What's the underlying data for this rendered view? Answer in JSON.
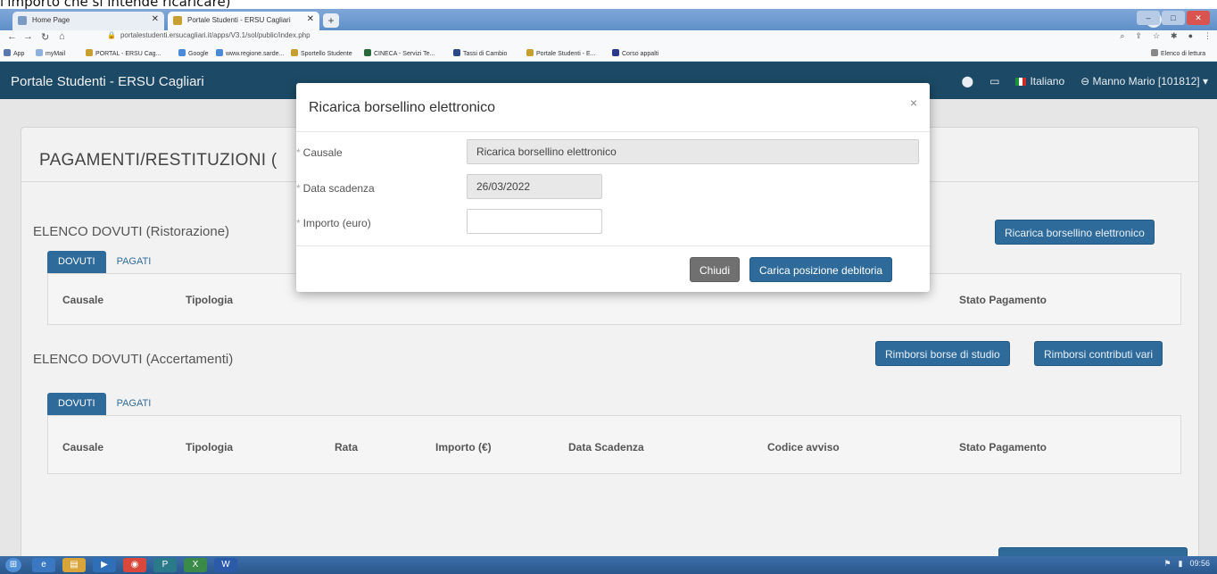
{
  "doc_fragment": "l'importo che si intende ricaricare)",
  "browser": {
    "tabs": [
      {
        "label": "Home Page"
      },
      {
        "label": "Portale Studenti - ERSU Cagliari"
      }
    ],
    "new_tab": "+",
    "url": "portalestudenti.ersucagliari.it/apps/V3.1/sol/public/index.php",
    "bookmarks": [
      "App",
      "myMail",
      "PORTAL - ERSU Cag...",
      "Google",
      "www.regione.sarde...",
      "Sportello Studente",
      "CINECA - Servizi Te...",
      "Tassi di Cambio",
      "Portale Studenti - E...",
      "Corso appalti"
    ],
    "reading_list": "Elenco di lettura"
  },
  "navbar": {
    "brand": "Portale Studenti - ERSU Cagliari",
    "language": "Italiano",
    "user": "Manno Mario [101812]"
  },
  "page": {
    "title": "PAGAMENTI/RESTITUZIONI (",
    "section1": {
      "title": "ELENCO DOVUTI (Ristorazione)",
      "button": "Ricarica borsellino elettronico",
      "tabs": [
        "DOVUTI",
        "PAGATI"
      ],
      "columns": [
        "Causale",
        "Tipologia",
        "Stato Pagamento"
      ]
    },
    "section2": {
      "title": "ELENCO DOVUTI (Accertamenti)",
      "buttons": [
        "Rimborsi borse di studio",
        "Rimborsi contributi vari"
      ],
      "tabs": [
        "DOVUTI",
        "PAGATI"
      ],
      "columns": [
        "Causale",
        "Tipologia",
        "Rata",
        "Importo (€)",
        "Data Scadenza",
        "Codice avviso",
        "Stato Pagamento"
      ]
    }
  },
  "modal": {
    "title": "Ricarica borsellino elettronico",
    "close": "×",
    "fields": {
      "causale_label": "Causale",
      "causale_value": "Ricarica borsellino elettronico",
      "scadenza_label": "Data scadenza",
      "scadenza_value": "26/03/2022",
      "importo_label": "Importo (euro)",
      "importo_value": ""
    },
    "buttons": {
      "close_label": "Chiudi",
      "submit_label": "Carica posizione debitoria"
    }
  },
  "taskbar": {
    "clock": "09:56"
  }
}
